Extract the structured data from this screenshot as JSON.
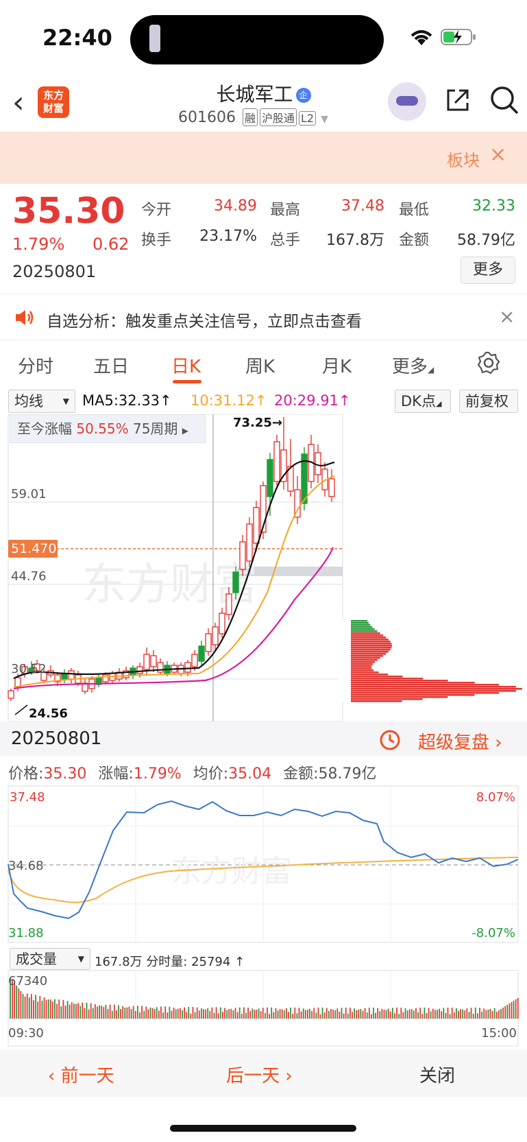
{
  "status": {
    "time": "22:40"
  },
  "header": {
    "logo": "东方\n财富",
    "stock_name": "长城军工",
    "badge": "企",
    "code": "601606",
    "tags": [
      "融",
      "沪股通",
      "L2"
    ]
  },
  "banner": {
    "text": "板块",
    "close": "×"
  },
  "quote": {
    "price": "35.30",
    "pct": "1.79%",
    "change": "0.62",
    "date": "20250801",
    "fields": [
      {
        "label": "今开",
        "value": "34.89",
        "color": "red"
      },
      {
        "label": "最高",
        "value": "37.48",
        "color": "red"
      },
      {
        "label": "最低",
        "value": "32.33",
        "color": "green"
      },
      {
        "label": "换手",
        "value": "23.17%",
        "color": "black"
      },
      {
        "label": "总手",
        "value": "167.8万",
        "color": "black"
      },
      {
        "label": "金额",
        "value": "58.79亿",
        "color": "black"
      }
    ],
    "more_label": "更多"
  },
  "notice": {
    "text": "自选分析：触发重点关注信号，立即点击查看",
    "close": "×"
  },
  "tabs": [
    "分时",
    "五日",
    "日K",
    "周K",
    "月K",
    "更多"
  ],
  "kbar": {
    "ma_select": "均线",
    "ma5": "MA5:32.33↑",
    "ma10": "10:31.12↑",
    "ma20": "20:29.91↑",
    "dk": "DK点",
    "fq": "前复权"
  },
  "kchart": {
    "period_label": "至今涨幅",
    "period_pct": "50.55%",
    "period_count": "75周期",
    "labels": {
      "high": "73.25→",
      "y1": "59.01",
      "y2": "51.470",
      "y3": "44.76",
      "y4": "30.52",
      "low": "24.56"
    },
    "watermark": "东方财富"
  },
  "info": {
    "date": "20250801",
    "replay": "超级复盘"
  },
  "minute": {
    "price_label": "价格:",
    "price": "35.30",
    "pct_label": "涨幅:",
    "pct": "1.79%",
    "avg_label": "均价:",
    "avg": "35.04",
    "amt_label": "金额:",
    "amt": "58.79亿",
    "ymax": "37.48",
    "ymid": "34.68",
    "ymin": "31.88",
    "pmax": "8.07%",
    "pmin": "-8.07%",
    "watermark": "东方财富"
  },
  "volume": {
    "select": "成交量",
    "total": "167.8万",
    "min_label": "分时量:",
    "min_value": "25794 ↑",
    "max": "67340",
    "t_start": "09:30",
    "t_end": "15:00"
  },
  "bottom": {
    "prev": "前一天",
    "next": "后一天",
    "close": "关闭"
  },
  "colors": {
    "accent": "#f0501f",
    "up": "#e53935",
    "down": "#1e9e3a",
    "ma5": "#000000",
    "ma10": "#f5a623",
    "ma20": "#d81b9a",
    "price_line": "#3a78c8",
    "avg_line": "#f5b041"
  }
}
